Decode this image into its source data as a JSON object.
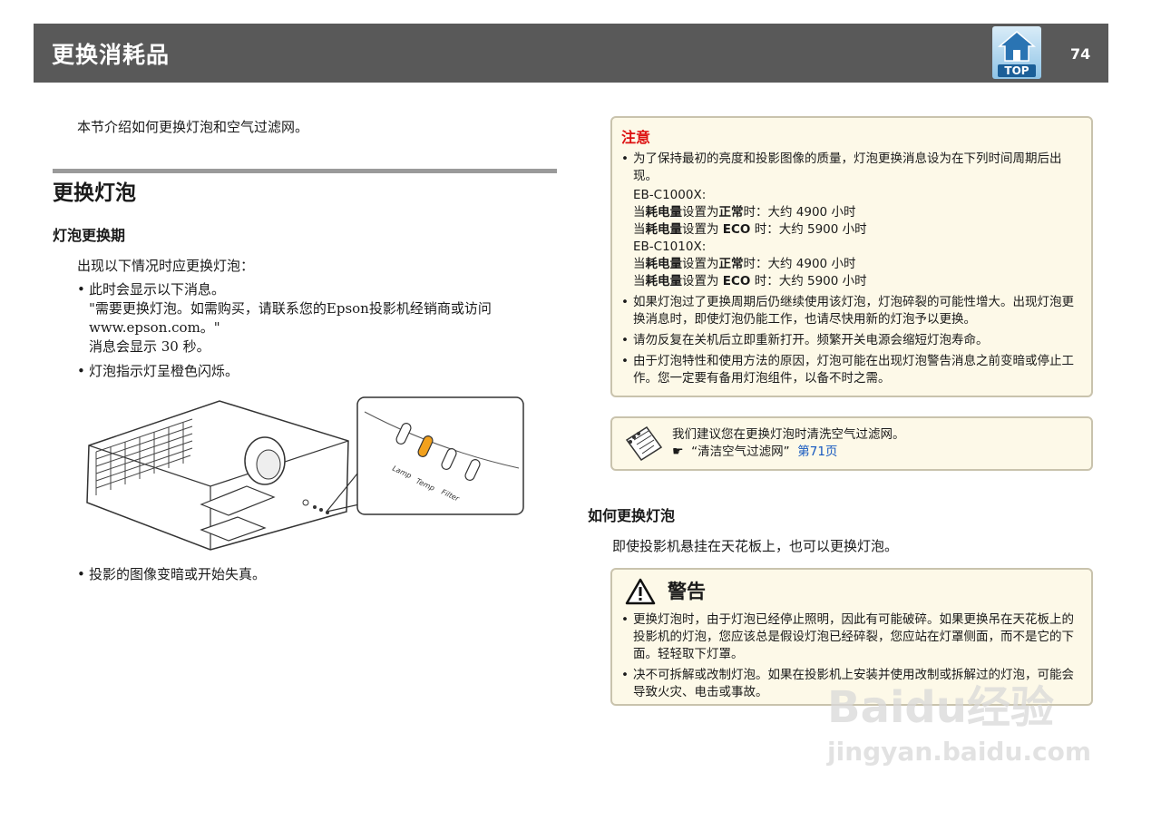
{
  "header": {
    "title": "更换消耗品",
    "top_label": "TOP",
    "page_number": "74"
  },
  "intro": "本节介绍如何更换灯泡和空气过滤网。",
  "section": {
    "title": "更换灯泡",
    "sub1_title": "灯泡更换期",
    "sub1_lead": "出现以下情况时应更换灯泡：",
    "bullet1_line1": "此时会显示以下消息。",
    "bullet1_line2": "\"需要更换灯泡。如需购买，请联系您的Epson投影机经销商或访问",
    "bullet1_line3": "www.epson.com。\"",
    "bullet1_line4": "消息会显示  30  秒。",
    "bullet2": "灯泡指示灯呈橙色闪烁。",
    "bullet3": "投影的图像变暗或开始失真。",
    "indicator_labels": [
      "Lamp",
      "Temp",
      "Filter"
    ]
  },
  "caution": {
    "title": "注意",
    "item1": "为了保持最初的亮度和投影图像的质量，灯泡更换消息设为在下列时间周期后出现。",
    "model1": "EB-C1000X:",
    "line_a_pre": "当",
    "line_a_b1": "耗电量",
    "line_a_mid": "设置为",
    "line_a_b2": "正常",
    "line_a_post": "时：大约  4900  小时",
    "line_b_pre": "当",
    "line_b_b1": "耗电量",
    "line_b_mid": "设置为  ",
    "line_b_b2": "ECO",
    "line_b_post": "  时：大约  5900  小时",
    "model2": "EB-C1010X:",
    "item2": "如果灯泡过了更换周期后仍继续使用该灯泡，灯泡碎裂的可能性增大。出现灯泡更换消息时，即使灯泡仍能工作，也请尽快用新的灯泡予以更换。",
    "item3": "请勿反复在关机后立即重新打开。频繁开关电源会缩短灯泡寿命。",
    "item4": "由于灯泡特性和使用方法的原因，灯泡可能在出现灯泡警告消息之前变暗或停止工作。您一定要有备用灯泡组件，以备不时之需。"
  },
  "tip": {
    "text": "我们建议您在更换灯泡时清洗空气过滤网。",
    "ref_text": "“清洁空气过滤网”",
    "ref_page": "第71页"
  },
  "section2": {
    "title": "如何更换灯泡",
    "lead": "即使投影机悬挂在天花板上，也可以更换灯泡。"
  },
  "warning": {
    "title": "警告",
    "item1": "更换灯泡时，由于灯泡已经停止照明，因此有可能破碎。如果更换吊在天花板上的投影机的灯泡，您应该总是假设灯泡已经碎裂，您应站在灯罩侧面，而不是它的下面。轻轻取下灯罩。",
    "item2": "决不可拆解或改制灯泡。如果在投影机上安装并使用改制或拆解过的灯泡，可能会导致火灾、电击或事故。"
  },
  "watermark": {
    "line1": "Baidu经验",
    "line2": "jingyan.baidu.com"
  }
}
